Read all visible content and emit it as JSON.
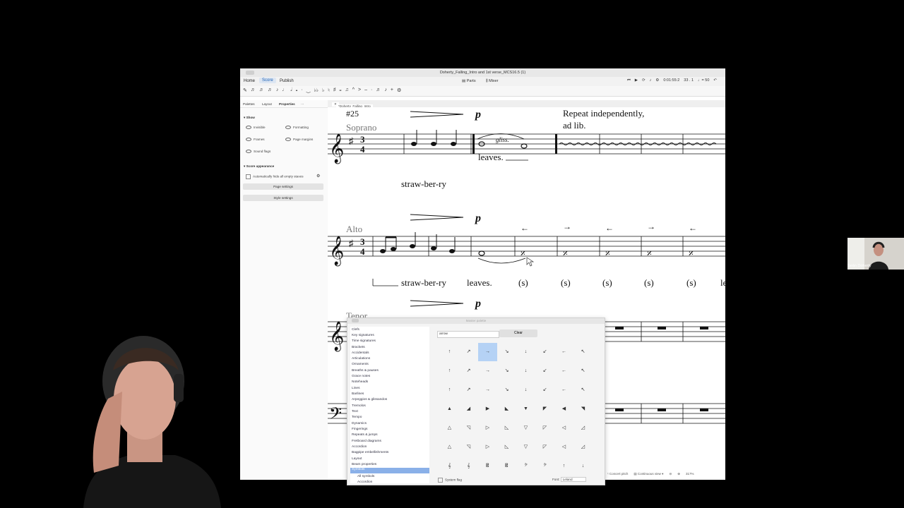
{
  "window": {
    "title": "Doherty_Falling_Intro and 1st verse_MCS16.5 (1)",
    "nav_tabs": [
      "Home",
      "Score",
      "Publish"
    ],
    "active_tab": "Score",
    "parts_label": "Parts",
    "mixer_label": "Mixer",
    "time": "0:01:55:2",
    "measure": "33 . 1",
    "tempo": "♩= 50"
  },
  "properties": {
    "tabs": [
      "Palettes",
      "Layout",
      "Properties"
    ],
    "show_section": "Show",
    "show_items": [
      "Invisible",
      "Formatting",
      "Frames",
      "Page margins",
      "Sound flags"
    ],
    "score_appearance": "Score appearance",
    "hide_staves": "Automatically hide all empty staves",
    "page_settings": "Page settings",
    "style_settings": "Style settings"
  },
  "document_tab": "*Doherty_Falling_Intro an...",
  "score": {
    "rehearsal": "#25",
    "instruments": [
      "Soprano",
      "Alto",
      "Tenor"
    ],
    "text_line1": "Repeat independently,",
    "text_line2": "ad lib.",
    "gliss": "gliss.",
    "lyric_leaves": "leaves.",
    "lyric_strawberry": "straw-ber-ry",
    "alto_lyrics": [
      "straw-ber-ry",
      "leaves.",
      "(s)",
      "(s)",
      "(s)",
      "(s)",
      "(s)",
      "le"
    ],
    "dynamic": "p",
    "time_sig": "3/4"
  },
  "master_palette": {
    "title": "Master palette",
    "categories": [
      "Clefs",
      "Key signatures",
      "Time signatures",
      "Brackets",
      "Accidentals",
      "Articulations",
      "Ornaments",
      "Breaths & pauses",
      "Grace notes",
      "Noteheads",
      "Lines",
      "Barlines",
      "Arpeggios & glissandos",
      "Tremolos",
      "Text",
      "Tempo",
      "Dynamics",
      "Fingerings",
      "Repeats & jumps",
      "Fretboard diagrams",
      "Accordion",
      "Bagpipe embellishments",
      "Layout",
      "Beam properties",
      "Symbols",
      "All symbols",
      "Accordion"
    ],
    "selected_category": "Symbols",
    "search_value": "arrow",
    "clear_label": "Clear",
    "system_flag": "System flag",
    "font_label": "Font:",
    "font_value": "Leland",
    "grid_rows": [
      [
        "↑",
        "↗",
        "→",
        "↘",
        "↓",
        "↙",
        "←",
        "↖"
      ],
      [
        "↑",
        "↗",
        "→",
        "↘",
        "↓",
        "↙",
        "←",
        "↖"
      ],
      [
        "↑",
        "↗",
        "→",
        "↘",
        "↓",
        "↙",
        "←",
        "↖"
      ],
      [
        "▲",
        "◢",
        "▶",
        "◣",
        "▼",
        "◤",
        "◀",
        "◥"
      ],
      [
        "△",
        "◹",
        "▷",
        "◺",
        "▽",
        "◸",
        "◁",
        "◿"
      ],
      [
        "△",
        "◹",
        "▷",
        "◺",
        "▽",
        "◸",
        "◁",
        "◿"
      ],
      [
        "𝄞",
        "𝄞",
        "𝄡",
        "𝄡",
        "𝄢",
        "𝄢",
        "↑",
        "↓"
      ]
    ]
  },
  "statusbar": {
    "concert_pitch": "Concert pitch",
    "view_mode": "Continuous view",
    "zoom": "317%"
  },
  "webcam": {
    "name": "Seán Doherty"
  }
}
